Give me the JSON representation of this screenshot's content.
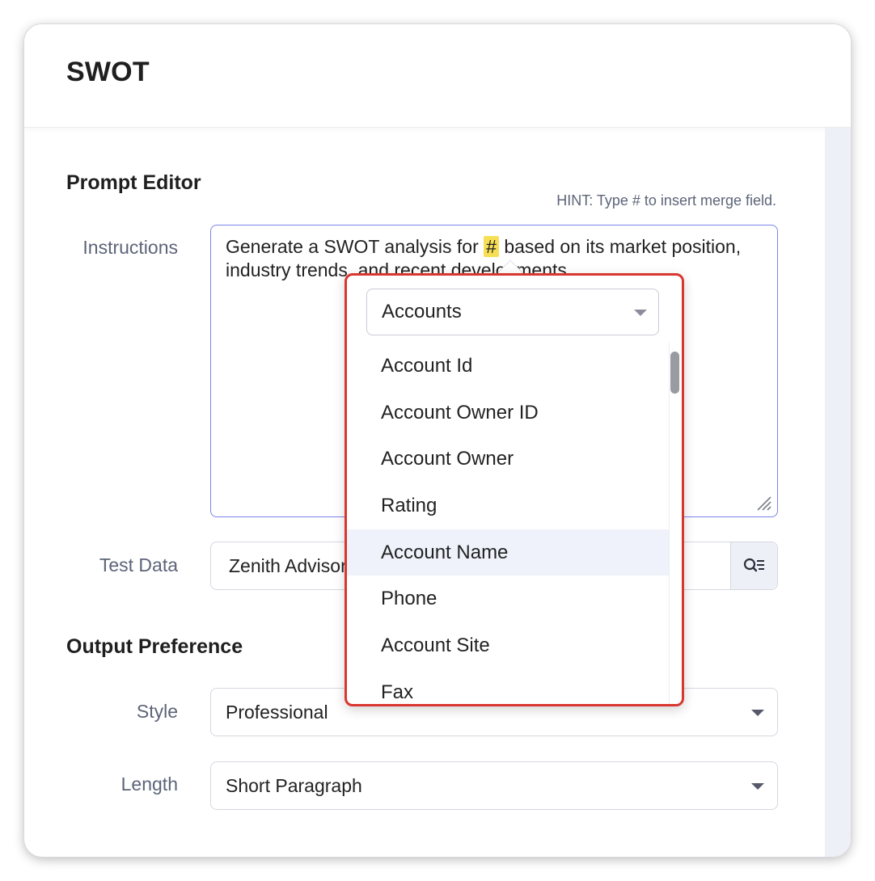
{
  "dialog": {
    "title": "SWOT"
  },
  "prompt_editor": {
    "section_title": "Prompt Editor",
    "hint": "HINT: Type # to insert merge field.",
    "instructions_label": "Instructions",
    "instructions_text_before": "Generate a SWOT analysis for ",
    "instructions_merge_marker": "#",
    "instructions_text_after": " based on its market position, industry trends, and recent developments.",
    "test_data_label": "Test Data",
    "test_data_value": "Zenith Advisors"
  },
  "output_preference": {
    "section_title": "Output Preference",
    "style_label": "Style",
    "style_value": "Professional",
    "length_label": "Length",
    "length_value": "Short Paragraph"
  },
  "merge_popup": {
    "module_value": "Accounts",
    "fields": [
      {
        "label": "Account Id",
        "active": false
      },
      {
        "label": "Account Owner ID",
        "active": false
      },
      {
        "label": "Account Owner",
        "active": false
      },
      {
        "label": "Rating",
        "active": false
      },
      {
        "label": "Account Name",
        "active": true
      },
      {
        "label": "Phone",
        "active": false
      },
      {
        "label": "Account Site",
        "active": false
      },
      {
        "label": "Fax",
        "active": false
      }
    ],
    "highlight_color": "#d9362f"
  },
  "icons": {
    "lookup": "search-list-icon",
    "resize": "resize-grip-icon",
    "caret": "caret-down-icon"
  }
}
